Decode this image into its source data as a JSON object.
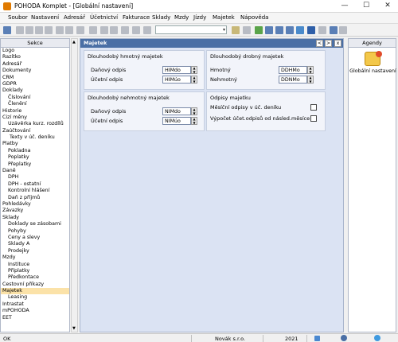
{
  "window": {
    "title": "POHODA Komplet - [Globální nastavení]",
    "minimize": "—",
    "maximize": "☐",
    "close": "✕"
  },
  "menu": [
    "Soubor",
    "Nastavení",
    "Adresář",
    "Účetnictví",
    "Fakturace",
    "Sklady",
    "Mzdy",
    "Jízdy",
    "Majetek",
    "Nápověda"
  ],
  "toolbar": {
    "combo_value": "",
    "combo_arrow": "▾"
  },
  "sidebar": {
    "title": "Sekce",
    "items": [
      {
        "label": "Logo",
        "level": 0
      },
      {
        "label": "Razítko",
        "level": 0
      },
      {
        "label": "Adresář",
        "level": 0
      },
      {
        "label": "Dokumenty",
        "level": 0
      },
      {
        "label": "CRM",
        "level": 0
      },
      {
        "label": "GDPR",
        "level": 0
      },
      {
        "label": "Doklady",
        "level": 0
      },
      {
        "label": "Číslování",
        "level": 1
      },
      {
        "label": "Členění",
        "level": 1
      },
      {
        "label": "Historie",
        "level": 0
      },
      {
        "label": "Cizí měny",
        "level": 0
      },
      {
        "label": "Uzávěrka kurz. rozdílů",
        "level": 1
      },
      {
        "label": "Zaúčtování",
        "level": 0
      },
      {
        "label": "Texty v úč. deníku",
        "level": 2
      },
      {
        "label": "Platby",
        "level": 0
      },
      {
        "label": "Pokladna",
        "level": 1
      },
      {
        "label": "Poplatky",
        "level": 1
      },
      {
        "label": "Přeplatky",
        "level": 1
      },
      {
        "label": "Daně",
        "level": 0
      },
      {
        "label": "DPH",
        "level": 1
      },
      {
        "label": "DPH - ostatní",
        "level": 1
      },
      {
        "label": "Kontrolní hlášení",
        "level": 1
      },
      {
        "label": "Daň z příjmů",
        "level": 1
      },
      {
        "label": "Pohledávky",
        "level": 0
      },
      {
        "label": "Závazky",
        "level": 0
      },
      {
        "label": "Sklady",
        "level": 0
      },
      {
        "label": "Doklady se zásobami",
        "level": 1
      },
      {
        "label": "Pohyby",
        "level": 1
      },
      {
        "label": "Ceny a slevy",
        "level": 1
      },
      {
        "label": "Sklady A",
        "level": 1
      },
      {
        "label": "Prodejky",
        "level": 1
      },
      {
        "label": "Mzdy",
        "level": 0
      },
      {
        "label": "Instituce",
        "level": 1
      },
      {
        "label": "Příplatky",
        "level": 1
      },
      {
        "label": "Předkontace",
        "level": 1
      },
      {
        "label": "Cestovní příkazy",
        "level": 0
      },
      {
        "label": "Majetek",
        "level": 0,
        "selected": true
      },
      {
        "label": "Leasing",
        "level": 1
      },
      {
        "label": "Intrastat",
        "level": 0
      },
      {
        "label": "mPOHODA",
        "level": 0
      },
      {
        "label": "EET",
        "level": 0
      }
    ],
    "scroll_up": "▲",
    "scroll_down": "▼"
  },
  "main": {
    "title": "Majetek",
    "nav_prev": "<",
    "nav_next": ">",
    "nav_close": "x",
    "dhm": {
      "title": "Dlouhodobý hmotný majetek",
      "danovy_label": "Daňový odpis",
      "danovy_value": "HIMdo",
      "ucetni_label": "Účetní odpis",
      "ucetni_value": "HIMúo"
    },
    "dnm": {
      "title": "Dlouhodobý nehmotný majetek",
      "danovy_label": "Daňový odpis",
      "danovy_value": "NIMdo",
      "ucetni_label": "Účetní odpis",
      "ucetni_value": "NIMúo"
    },
    "ddm": {
      "title": "Dlouhodobý drobný majetek",
      "hmotny_label": "Hmotný",
      "hmotny_value": "DDHMo",
      "nehmotny_label": "Nehmotný",
      "nehmotny_value": "DDNMo"
    },
    "odpisy": {
      "title": "Odpisy majetku",
      "mesicni_label": "Měsíční odpisy v úč. deníku",
      "vypocet_label": "Výpočet účet.odpisů od násled.měsíce"
    }
  },
  "agendy": {
    "title": "Agendy",
    "item": "Globální nastavení"
  },
  "status": {
    "left": "OK",
    "company": "Novák s.r.o.",
    "year": "2021"
  }
}
